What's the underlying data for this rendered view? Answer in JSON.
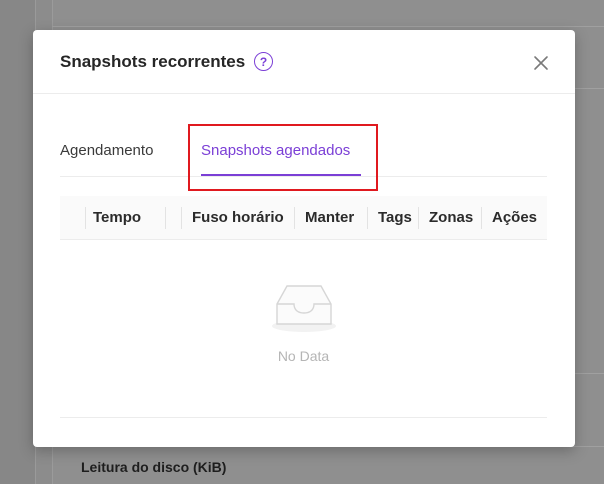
{
  "background": {
    "section_title": "Leitura do disco (KiB)"
  },
  "modal": {
    "title": "Snapshots recorrentes",
    "help_icon": "question-circle-icon",
    "close_icon": "close-icon",
    "tabs": [
      {
        "label": "Agendamento",
        "active": false
      },
      {
        "label": "Snapshots agendados",
        "active": true
      }
    ],
    "table": {
      "columns": [
        "Tempo",
        "Fuso horário",
        "Manter",
        "Tags",
        "Zonas",
        "Ações"
      ],
      "rows": [],
      "empty_text": "No Data",
      "empty_icon": "inbox-icon"
    }
  },
  "colors": {
    "accent": "#7b3fd6",
    "highlight": "#e0191f"
  }
}
